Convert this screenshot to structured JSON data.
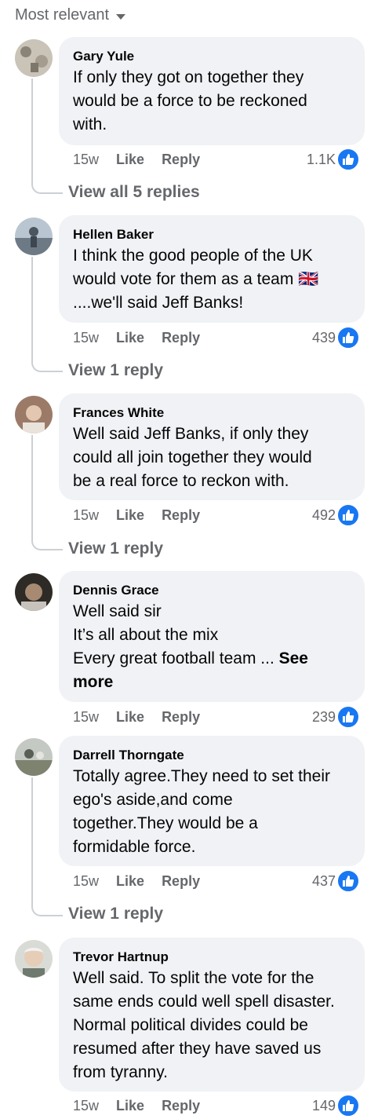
{
  "sort_label": "Most relevant",
  "comments": [
    {
      "author": "Gary Yule",
      "text": "If only they got on together they\nwould be a force to be reckoned\nwith.",
      "time": "15w",
      "like": "Like",
      "reply": "Reply",
      "count": "1.1K",
      "view_replies": "View all 5 replies"
    },
    {
      "author": "Hellen Baker",
      "text": "I think the good people of the UK\nwould vote for them as a team 🇬🇧\n....we'll said Jeff Banks!",
      "time": "15w",
      "like": "Like",
      "reply": "Reply",
      "count": "439",
      "view_replies": "View 1 reply"
    },
    {
      "author": "Frances White",
      "text": "Well said Jeff Banks, if only they\ncould all join together they would\nbe a real force to reckon with.",
      "time": "15w",
      "like": "Like",
      "reply": "Reply",
      "count": "492",
      "view_replies": "View 1 reply"
    },
    {
      "author": "Dennis Grace",
      "text": "Well said sir\nIt’s all about the mix\nEvery great football team ... ",
      "see_more": "See\nmore",
      "time": "15w",
      "like": "Like",
      "reply": "Reply",
      "count": "239"
    },
    {
      "author": "Darrell Thorngate",
      "text": "Totally agree.They need to set their\nego's aside,and come\ntogether.They would be a\nformidable force.",
      "time": "15w",
      "like": "Like",
      "reply": "Reply",
      "count": "437",
      "view_replies": "View 1 reply"
    },
    {
      "author": "Trevor Hartnup",
      "text": "Well said. To split the vote for the\nsame ends could well spell disaster.\nNormal political divides could be\nresumed after they have saved us\nfrom tyranny.",
      "time": "15w",
      "like": "Like",
      "reply": "Reply",
      "count": "149"
    }
  ],
  "colors": {
    "bubble": "#f0f2f5",
    "secondary_text": "#65676b",
    "like_blue": "#1877f2"
  },
  "icons": [
    "caret-down-icon",
    "thumbs-up-icon"
  ]
}
